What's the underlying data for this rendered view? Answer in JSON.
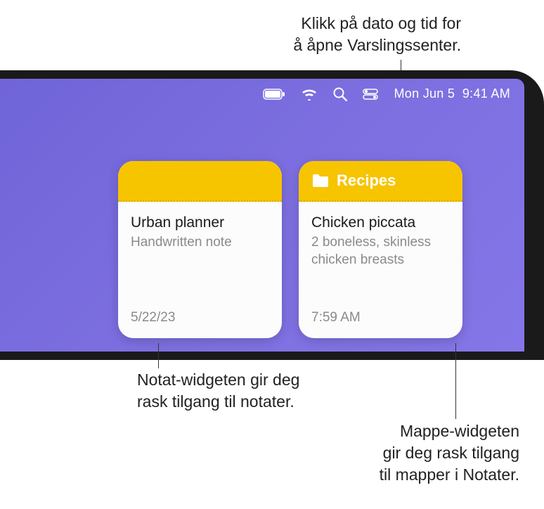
{
  "callouts": {
    "top": "Klikk på dato og tid for\nå åpne Varslingssenter.",
    "bottom_left": "Notat-widgeten gir deg\nrask tilgang til notater.",
    "bottom_right": "Mappe-widgeten\ngir deg rask tilgang\ntil mapper i Notater."
  },
  "menu_bar": {
    "date": "Mon Jun 5",
    "time": "9:41 AM"
  },
  "widgets": {
    "note": {
      "title": "Urban planner",
      "subtitle": "Handwritten note",
      "date": "5/22/23"
    },
    "folder": {
      "header_label": "Recipes",
      "title": "Chicken piccata",
      "subtitle": "2 boneless, skinless chicken breasts",
      "time": "7:59 AM"
    }
  }
}
